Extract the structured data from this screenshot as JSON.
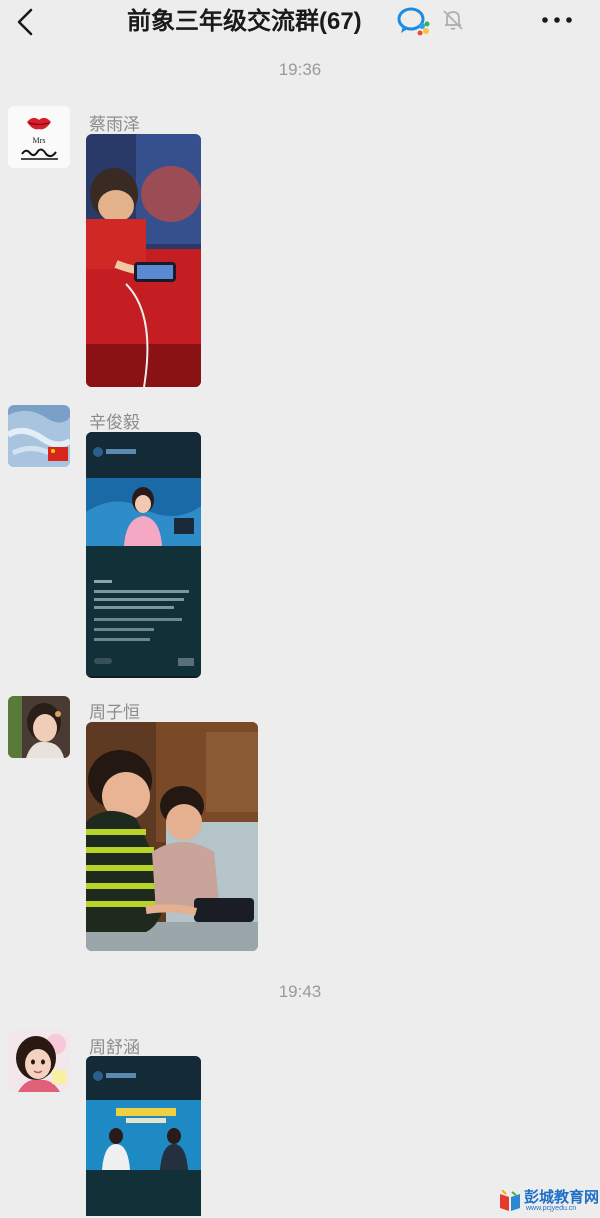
{
  "header": {
    "title": "前象三年级交流群(67)",
    "back_icon": "chevron-left-icon",
    "chat_icon": "chat-bubble-icon",
    "mute_icon": "bell-muted-icon",
    "more_icon": "more-dots-icon"
  },
  "timestamps": [
    "19:36",
    "19:43"
  ],
  "messages": [
    {
      "sender": "蔡雨泽",
      "avatar_text": "Mrs",
      "avatar_sign": "彭辉"
    },
    {
      "sender": "辛俊毅"
    },
    {
      "sender": "周子恒"
    },
    {
      "sender": "周舒涵"
    }
  ],
  "watermark": {
    "text": "彭城教育网",
    "url": "www.pcjyedu.cn"
  },
  "colors": {
    "background": "#ededed",
    "timestamp": "#9a9a9a",
    "sender": "#8c8c8c",
    "watermark": "#1e6fc8"
  }
}
